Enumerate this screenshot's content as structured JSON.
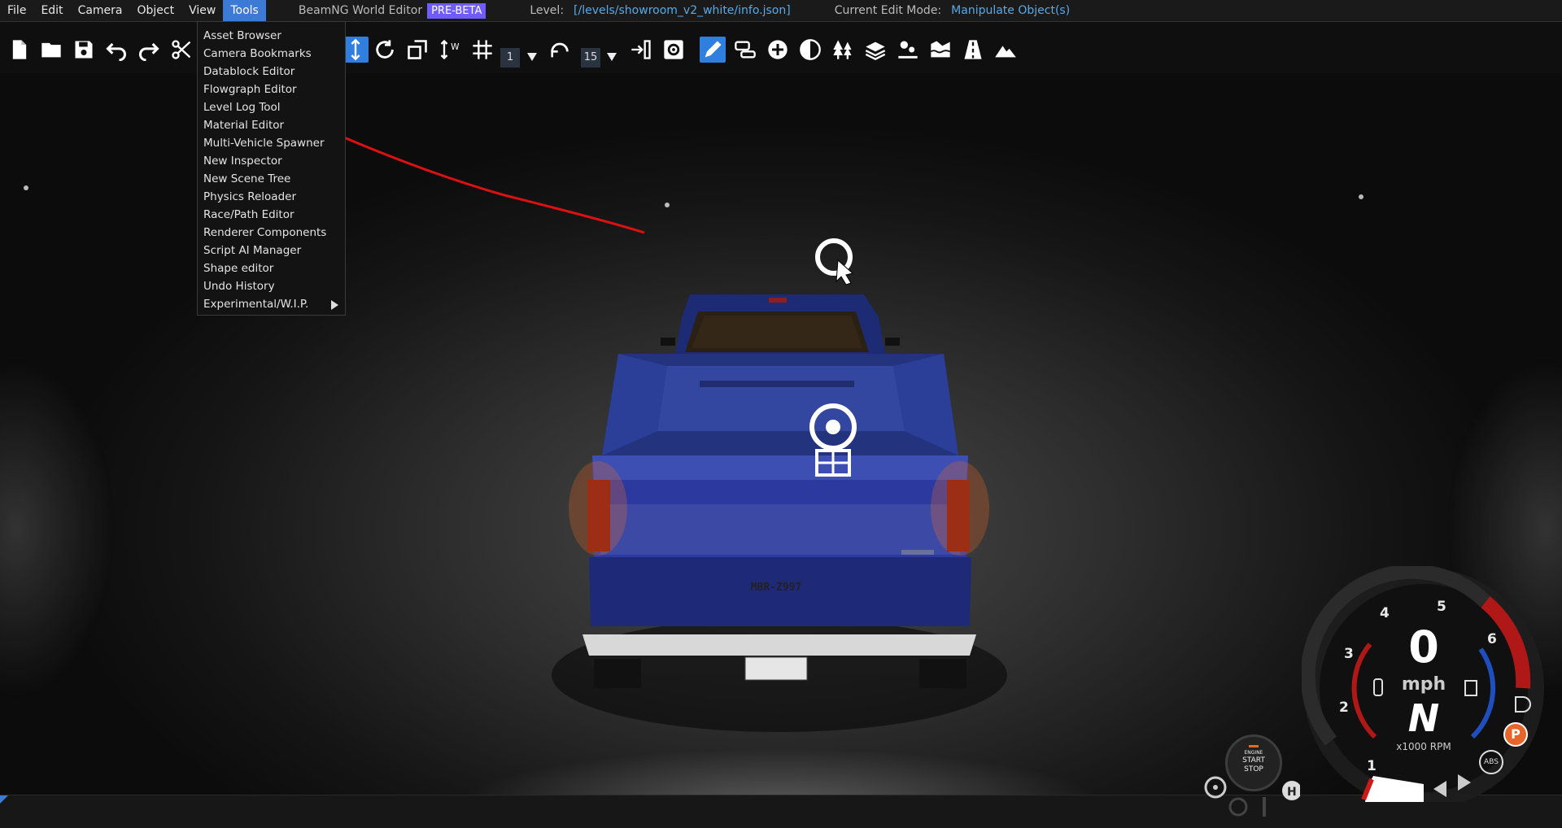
{
  "menubar": {
    "items": [
      "File",
      "Edit",
      "Camera",
      "Object",
      "View",
      "Tools"
    ],
    "app_title": "BeamNG World Editor",
    "badge": "PRE-BETA",
    "level_label": "Level:",
    "level_path": "[/levels/showroom_v2_white/info.json]",
    "mode_label": "Current Edit Mode:",
    "mode_value": "Manipulate Object(s)"
  },
  "toolbar": {
    "grid_value": "1",
    "snap_value": "15"
  },
  "tools_menu": {
    "items": [
      "Asset Browser",
      "Camera Bookmarks",
      "Datablock Editor",
      "Flowgraph Editor",
      "Level Log Tool",
      "Material Editor",
      "Multi-Vehicle Spawner",
      "New Inspector",
      "New Scene Tree",
      "Physics Reloader",
      "Race/Path Editor",
      "Renderer Components",
      "Script AI Manager",
      "Shape editor",
      "Undo History",
      "Experimental/W.I.P."
    ]
  },
  "vehicle": {
    "plate": "MBR-Z997"
  },
  "dashboard": {
    "speed": "0",
    "unit": "mph",
    "gear": "N",
    "rpm_label": "x1000 RPM",
    "ticks": [
      "1",
      "2",
      "3",
      "4",
      "5",
      "6"
    ],
    "abs": "ABS",
    "parking": "P",
    "engine": [
      "ENGINE",
      "START",
      "STOP"
    ],
    "accent_red": "#b01818",
    "accent_blue": "#1f4fbf"
  }
}
